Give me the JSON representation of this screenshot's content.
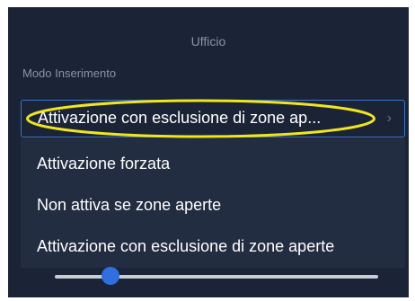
{
  "header": {
    "title": "Ufficio"
  },
  "mode_field": {
    "label": "Modo Inserimento",
    "selected_value": "Attivazione con esclusione di zone ap...",
    "chevron_icon": "chevron-right-icon",
    "options": [
      "Attivazione forzata",
      "Non attiva se zone aperte",
      "Attivazione con esclusione di zone aperte"
    ]
  },
  "colors": {
    "background": "#1b2436",
    "dropdown_background": "#232d42",
    "accent": "#2f6fe0",
    "highlight": "#f0e61e"
  }
}
